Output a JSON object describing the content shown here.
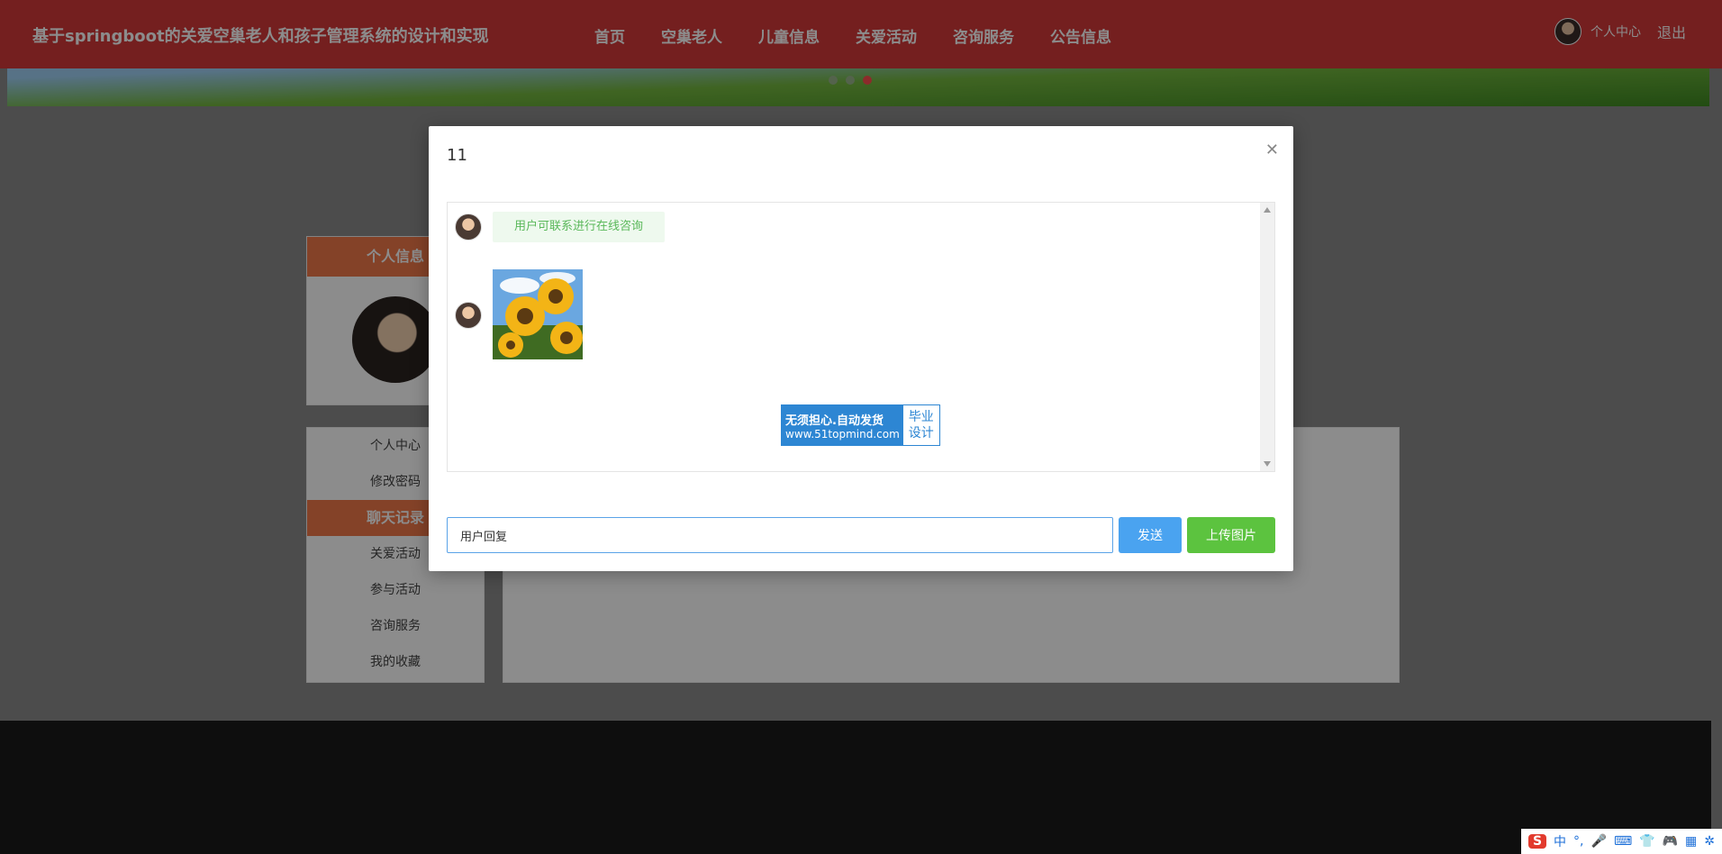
{
  "header": {
    "site_title": "基于springboot的关爱空巢老人和孩子管理系统的设计和实现",
    "nav": [
      "首页",
      "空巢老人",
      "儿童信息",
      "关爱活动",
      "咨询服务",
      "公告信息"
    ],
    "user_center": "个人中心",
    "logout": "退出"
  },
  "sidebar": {
    "profile_heading": "个人信息",
    "menu": [
      {
        "label": "个人中心",
        "active": false
      },
      {
        "label": "修改密码",
        "active": false
      },
      {
        "label": "聊天记录",
        "active": true
      },
      {
        "label": "关爱活动",
        "active": false
      },
      {
        "label": "参与活动",
        "active": false
      },
      {
        "label": "咨询服务",
        "active": false
      },
      {
        "label": "我的收藏",
        "active": false
      }
    ]
  },
  "modal": {
    "title": "11",
    "close_icon": "close-icon",
    "messages": [
      {
        "type": "text",
        "text": "用户可联系进行在线咨询"
      },
      {
        "type": "image",
        "image": "sunflower"
      }
    ],
    "watermark": {
      "line1": "无须担心.自动发货",
      "line2": "www.51topmind.com",
      "right1": "毕业",
      "right2": "设计"
    },
    "reply_value": "用户回复",
    "send_label": "发送",
    "upload_label": "上传图片"
  },
  "tray": {
    "items": [
      "S",
      "中",
      "°,",
      "🎤",
      "⌨",
      "👕",
      "🎮",
      "▦",
      "✲"
    ]
  },
  "colors": {
    "header": "#d33a3a",
    "accent_orange": "#f0784a",
    "send_button": "#4aa3f0",
    "upload_button": "#5cc33f",
    "bubble_text": "#5ab85a"
  }
}
